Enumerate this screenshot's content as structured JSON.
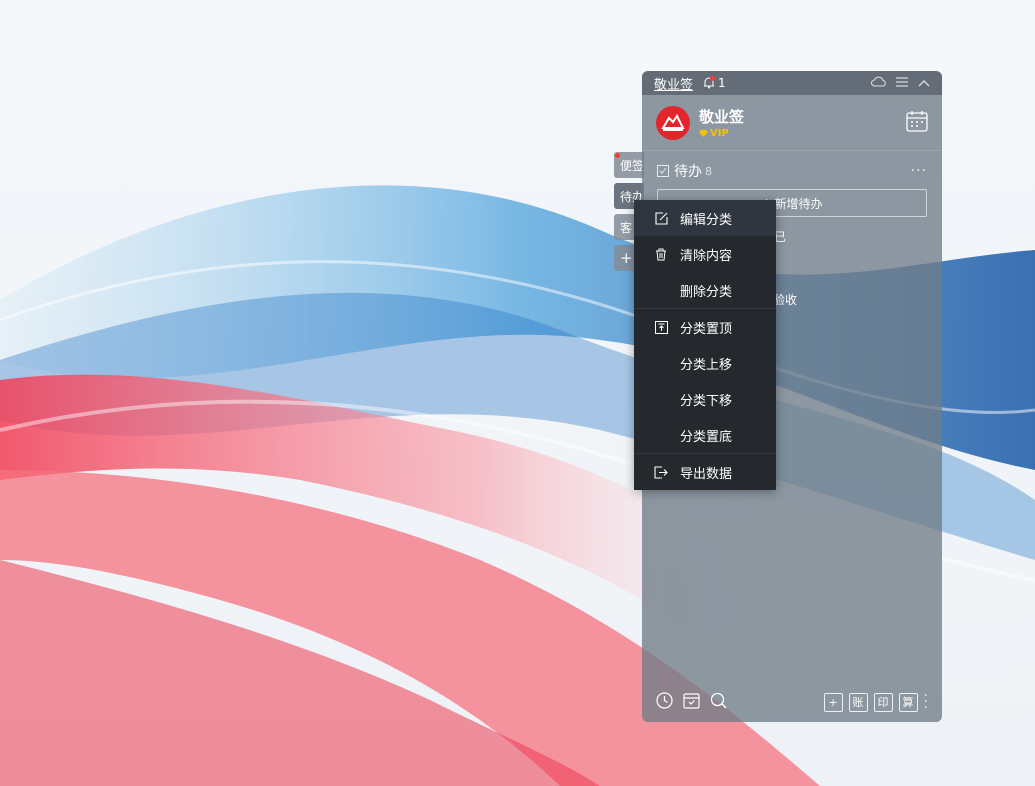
{
  "app": {
    "title": "敬业签",
    "notification_count": "1",
    "user_name": "敬业签",
    "vip_label": "VIP"
  },
  "tabs": [
    {
      "label": "便签"
    },
    {
      "label": "待办"
    },
    {
      "label": "客"
    },
    {
      "label": "+"
    }
  ],
  "todo": {
    "header": "待办",
    "count": "8",
    "more": "···",
    "new_button": "新增待办",
    "items": [
      {
        "text": "已"
      },
      {
        "text": "验收"
      }
    ]
  },
  "context_menu": {
    "items": [
      {
        "label": "编辑分类",
        "icon": "edit-icon"
      },
      {
        "label": "清除内容",
        "icon": "trash-icon"
      },
      {
        "label": "删除分类",
        "icon": ""
      },
      {
        "label": "分类置顶",
        "icon": "pin-top-icon"
      },
      {
        "label": "分类上移",
        "icon": ""
      },
      {
        "label": "分类下移",
        "icon": ""
      },
      {
        "label": "分类置底",
        "icon": ""
      },
      {
        "label": "导出数据",
        "icon": "export-icon"
      }
    ]
  },
  "footer": {
    "buttons": [
      {
        "label": "+"
      },
      {
        "label": "账"
      },
      {
        "label": "印"
      },
      {
        "label": "算"
      }
    ]
  },
  "colors": {
    "avatar_red": "#e3262b",
    "vip_gold": "#f5c400",
    "menu_bg": "#25282d"
  }
}
